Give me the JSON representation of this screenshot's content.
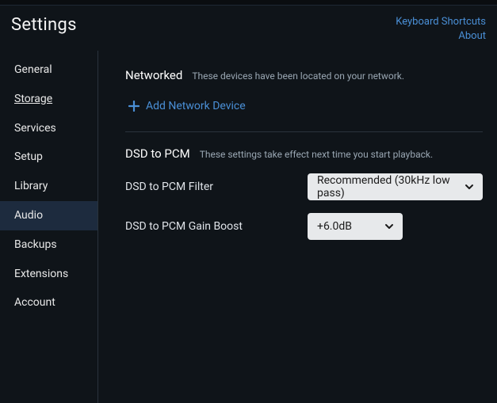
{
  "header": {
    "title": "Settings",
    "links": {
      "shortcuts": "Keyboard Shortcuts",
      "about": "About"
    }
  },
  "sidebar": {
    "items": [
      {
        "label": "General"
      },
      {
        "label": "Storage"
      },
      {
        "label": "Services"
      },
      {
        "label": "Setup"
      },
      {
        "label": "Library"
      },
      {
        "label": "Audio"
      },
      {
        "label": "Backups"
      },
      {
        "label": "Extensions"
      },
      {
        "label": "Account"
      }
    ]
  },
  "sections": {
    "networked": {
      "heading": "Networked",
      "subtitle": "These devices have been located on your network.",
      "add_label": "Add Network Device"
    },
    "dsd": {
      "heading": "DSD to PCM",
      "subtitle": "These settings take effect next time you start playback.",
      "filter_label": "DSD to PCM Filter",
      "filter_value": "Recommended (30kHz low pass)",
      "gain_label": "DSD to PCM Gain Boost",
      "gain_value": "+6.0dB"
    }
  }
}
